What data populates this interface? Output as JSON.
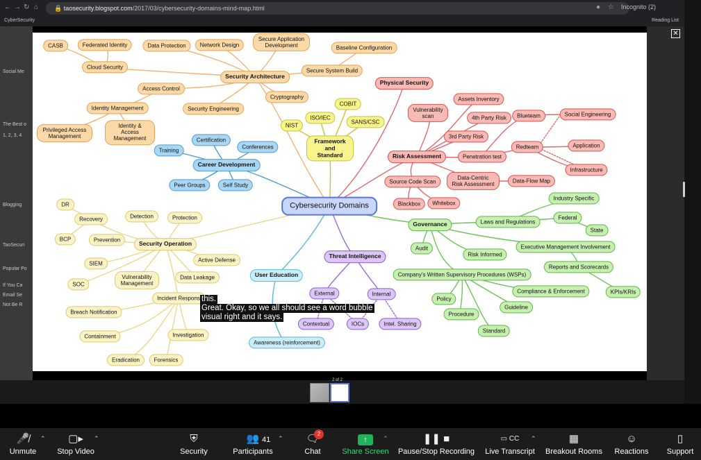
{
  "browser": {
    "url_host": "taosecurity.blogspot.com",
    "url_path": "/2017/03/cybersecurity-domains-mind-map.html",
    "incognito_label": "Incognito (2)",
    "bookmark_left": "CyberSecurity",
    "bookmark_right": "Reading List"
  },
  "page_strip": [
    "Social Me",
    "The Best o",
    "1, 2, 3, 4",
    "Blogging",
    "TaoSecuri",
    "Popular Po",
    "If You Ca",
    "Email Se",
    "Not Be R"
  ],
  "mindmap": {
    "center": "Cybersecurity Domains",
    "nodes": {
      "casb": "CASB",
      "federated_identity": "Federated Identity",
      "cloud_security": "Cloud Security",
      "data_protection": "Data Protection",
      "network_design": "Network Design",
      "secure_app_dev": "Secure Application Development",
      "baseline_config": "Baseline Configuration",
      "secure_system_build": "Secure System Build",
      "security_architecture": "Security Architecture",
      "access_control": "Access Control",
      "cryptography": "Cryptography",
      "identity_management": "Identity Management",
      "security_engineering": "Security Engineering",
      "pam": "Privileged Access Management",
      "iam": "Identity & Access Management",
      "physical_security": "Physical Security",
      "cobit": "COBIT",
      "iso_iec": "ISO/IEC",
      "nist": "NIST",
      "sans_csc": "SANS/CSC",
      "framework_standard": "Framework and Standard",
      "certification": "Certification",
      "training": "Training",
      "conferences": "Conferences",
      "career_development": "Career Development",
      "peer_groups": "Peer Groups",
      "self_study": "Self Study",
      "assets_inventory": "Assets Inventory",
      "vuln_scan": "Vulnerability scan",
      "fourth_party": "4th Party Risk",
      "third_party": "3rd Party Risk",
      "blueteam": "Blueteam",
      "social_engineering": "Social Engineering",
      "redteam": "Redteam",
      "application": "Application",
      "penetration_test": "Penetration test",
      "infrastructure": "Infrastructure",
      "risk_assessment": "Risk Assessment",
      "source_code_scan": "Source Code Scan",
      "data_centric": "Data-Centric Risk Assessment",
      "data_flow_map": "Data-Flow Map",
      "blackbox": "Blackbox",
      "whitebox": "Whitebox",
      "dr": "DR",
      "recovery": "Recovery",
      "detection": "Detection",
      "protection": "Protection",
      "bcp": "BCP",
      "prevention": "Prevention",
      "security_operation": "Security Operation",
      "siem": "SIEM",
      "active_defense": "Active Defense",
      "vuln_management": "Vulnerability Management",
      "soc": "SOC",
      "data_leakage": "Data Leakage",
      "incident_response": "Incident Respons",
      "breach_notification": "Breach Notification",
      "containment": "Containment",
      "investigation": "Investigation",
      "eradication": "Eradication",
      "forensics": "Forensics",
      "user_education": "User Education",
      "awareness": "Awareness (reinforcement)",
      "threat_intelligence": "Threat Intelligence",
      "external": "External",
      "internal": "Internal",
      "contextual": "Contextual",
      "iocs": "IOCs",
      "intel_sharing": "Intel. Sharing",
      "governance": "Governance",
      "industry_specific": "Industry Specific",
      "laws_regulations": "Laws and Regulations",
      "federal": "Federal",
      "state": "State",
      "audit": "Audit",
      "exec_mgmt": "Executive Management Involvement",
      "risk_informed": "Risk Informed",
      "reports_scorecards": "Reports and Scorecards",
      "wsps": "Company's Written Supervisory Procedures (WSPs)",
      "compliance": "Compliance & Enforcement",
      "kpis": "KPIs/KRIs",
      "policy": "Policy",
      "guideline": "Guideline",
      "procedure": "Procedure",
      "standard": "Standard"
    }
  },
  "caption": {
    "line1": "this.",
    "line2": "Great. Okay, so we all should see a word bubble",
    "line3": "visual right and it says."
  },
  "page_indicator": "2 of 2",
  "toolbar": {
    "unmute": "Unmute",
    "stop_video": "Stop Video",
    "security": "Security",
    "participants": "Participants",
    "participants_count": "41",
    "chat": "Chat",
    "chat_badge": "2",
    "share_screen": "Share Screen",
    "pause_stop": "Pause/Stop Recording",
    "live_transcript": "Live Transcript",
    "breakout_rooms": "Breakout Rooms",
    "reactions": "Reactions",
    "support": "Support"
  },
  "colors": {
    "share_green": "#21b35b",
    "badge_red": "#e0342b",
    "center_blue": "#c9d6fb"
  }
}
